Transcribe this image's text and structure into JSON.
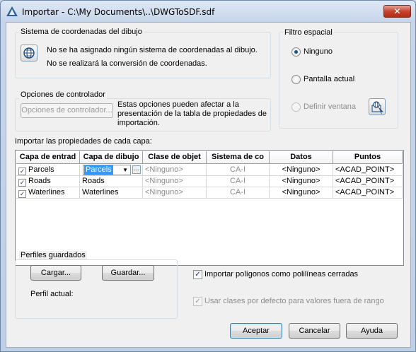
{
  "window": {
    "title": "Importar - C:\\My Documents\\..\\DWGToSDF.sdf",
    "close_glyph": "✕"
  },
  "coord_system": {
    "label": "Sistema de coordenadas del dibujo",
    "line1": "No se ha asignado ningún sistema de coordenadas al dibujo.",
    "line2": "No se realizará la conversión de coordenadas.",
    "icon": "globe-icon"
  },
  "spatial_filter": {
    "label": "Filtro espacial",
    "options": [
      {
        "label": "Ninguno",
        "checked": true,
        "enabled": true
      },
      {
        "label": "Pantalla actual",
        "checked": false,
        "enabled": true
      },
      {
        "label": "Definir ventana",
        "checked": false,
        "enabled": false
      }
    ],
    "window_icon": "pick-window-icon"
  },
  "driver_options": {
    "label": "Opciones de controlador",
    "button": "Opciones de controlador...",
    "desc1": "Estas opciones pueden afectar a la",
    "desc2": "presentación de la tabla de propiedades de",
    "desc3": "importación."
  },
  "import_props_label": "Importar las propiedades de cada capa:",
  "grid": {
    "columns": [
      "Capa de entrad",
      "Capa de dibujo",
      "Clase de objet",
      "Sistema de co",
      "Datos",
      "Puntos"
    ],
    "rows": [
      {
        "checked": true,
        "input": "Parcels",
        "drawing": "Parcels",
        "class": "<Ninguno>",
        "cs": "CA-I",
        "data": "<Ninguno>",
        "points": "<ACAD_POINT>"
      },
      {
        "checked": true,
        "input": "Roads",
        "drawing": "Roads",
        "class": "<Ninguno>",
        "cs": "CA-I",
        "data": "<Ninguno>",
        "points": "<ACAD_POINT>"
      },
      {
        "checked": true,
        "input": "Waterlines",
        "drawing": "Waterlines",
        "class": "<Ninguno>",
        "cs": "CA-I",
        "data": "<Ninguno>",
        "points": "<ACAD_POINT>"
      }
    ],
    "ellipsis": "...",
    "check_glyph": "✓"
  },
  "profiles": {
    "label": "Perfiles guardados",
    "load": "Cargar...",
    "save": "Guardar...",
    "current_label": "Perfil actual:"
  },
  "options": {
    "closed_polygons": {
      "label": "Importar polígonos como polilíneas cerradas",
      "checked": true,
      "enabled": true
    },
    "default_classes": {
      "label": "Usar clases por defecto para valores fuera de rango",
      "checked": true,
      "enabled": false
    }
  },
  "buttons": {
    "accept": "Aceptar",
    "cancel": "Cancelar",
    "help": "Ayuda"
  },
  "colors": {
    "selection": "#3399ff",
    "close_button": "#c7442f"
  }
}
